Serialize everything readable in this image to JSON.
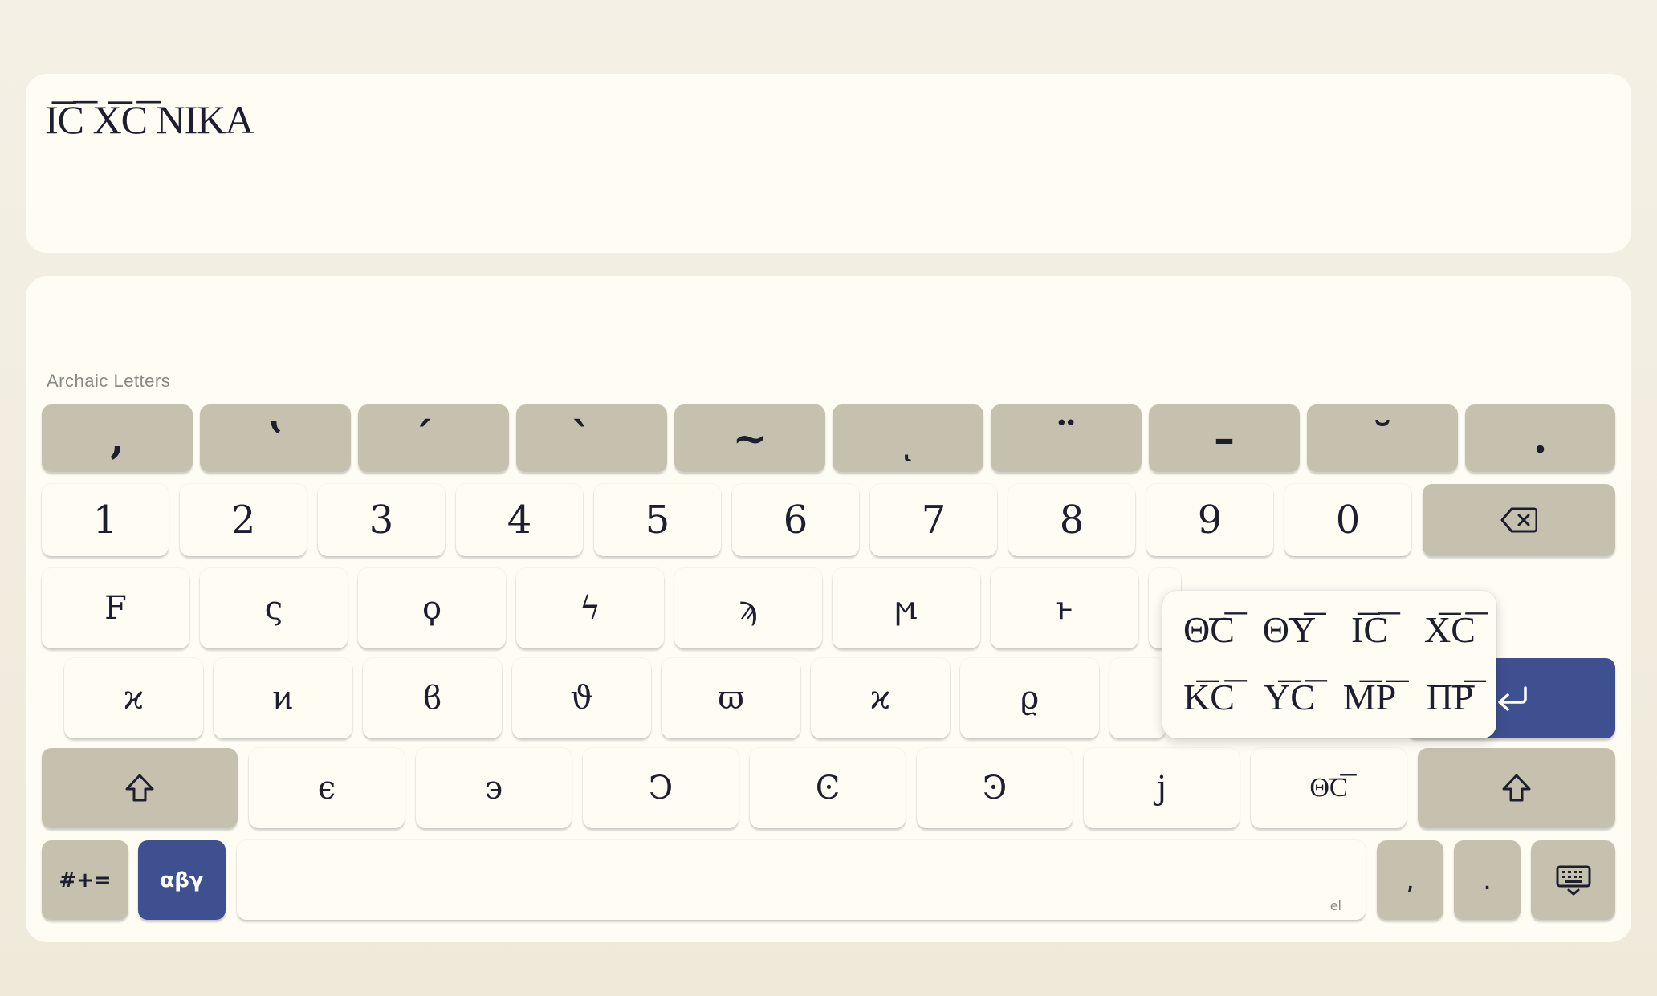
{
  "editor": {
    "text": "I͞C͞ X͞C͞ NIKA"
  },
  "keyboard": {
    "row_label": "Archaic Letters",
    "accents": [
      ",",
      "ʽ",
      "́",
      "̀",
      "~",
      "ͅ",
      "¨",
      "–",
      "˘",
      "."
    ],
    "digits": [
      "1",
      "2",
      "3",
      "4",
      "5",
      "6",
      "7",
      "8",
      "9",
      "0"
    ],
    "row1": [
      "F",
      "ς",
      "ϙ",
      "ϟ",
      "ϡ",
      "ϻ",
      "ͱ"
    ],
    "row2": [
      "ϰ",
      "ͷ",
      "ϐ",
      "ϑ",
      "ϖ",
      "ϰ",
      "ϱ"
    ],
    "row3": [
      "ϵ",
      "϶",
      "Ͻ",
      "Ͼ",
      "Ͽ",
      "ϳ",
      "Θ͞C͞"
    ],
    "symbols_label": "#+=",
    "greek_label": "αβγ",
    "space_hint": "el",
    "comma": ",",
    "period": "."
  },
  "popup": {
    "items": [
      "Θ͞C͞",
      "Θ͞Y͞",
      "I͞C͞",
      "X͞C͞",
      "K͞C͞",
      "Y͞C͞",
      "M͞P͞",
      "Π͞P͞"
    ]
  },
  "icons": {
    "backspace": "backspace-icon",
    "shift": "shift-icon",
    "enter": "enter-icon",
    "keyboard": "keyboard-icon"
  },
  "colors": {
    "accent": "#3e5090",
    "dark_key": "#c6c1ae",
    "light_key": "#fefcf3"
  }
}
